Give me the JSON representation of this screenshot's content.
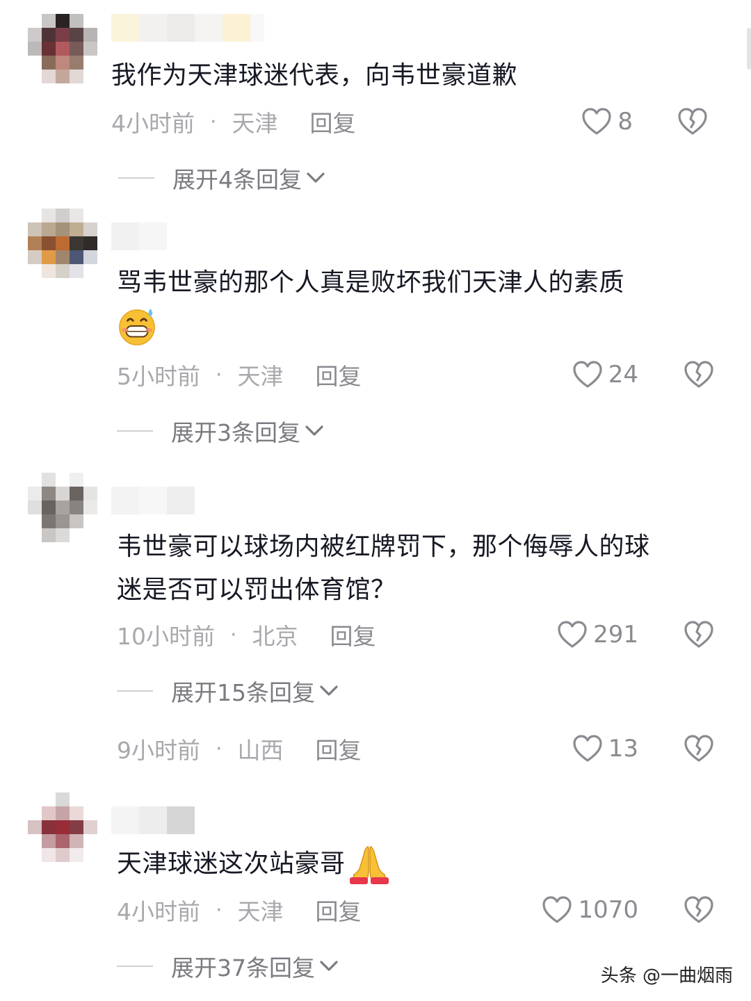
{
  "comments": [
    {
      "text_lines": [
        "我作为天津球迷代表，向韦世豪道歉"
      ],
      "time": "4小时前",
      "location": "天津",
      "reply_label": "回复",
      "likes": "8",
      "expand_label": "展开4条回复"
    },
    {
      "text_lines": [
        "骂韦世豪的那个人真是败坏我们天津人的素质"
      ],
      "emoji": "grinning-sweat-face-emoji",
      "time": "5小时前",
      "location": "天津",
      "reply_label": "回复",
      "likes": "24",
      "expand_label": "展开3条回复"
    },
    {
      "text_lines": [
        "韦世豪可以球场内被红牌罚下，那个侮辱人的球",
        "迷是否可以罚出体育馆？"
      ],
      "time": "10小时前",
      "location": "北京",
      "reply_label": "回复",
      "likes": "291",
      "expand_label": "展开15条回复"
    },
    {
      "time": "9小时前",
      "location": "山西",
      "reply_label": "回复",
      "likes": "13"
    },
    {
      "text_lines": [
        "天津球迷这次站豪哥"
      ],
      "emoji": "praying-hands-emoji",
      "time": "4小时前",
      "location": "天津",
      "reply_label": "回复",
      "likes": "1070",
      "expand_label": "展开37条回复"
    }
  ],
  "separator_dot": "·",
  "watermark": "头条 @一曲烟雨",
  "colors": {
    "text": "#161823",
    "meta": "#a8a8ad",
    "action": "#8a8a90"
  }
}
